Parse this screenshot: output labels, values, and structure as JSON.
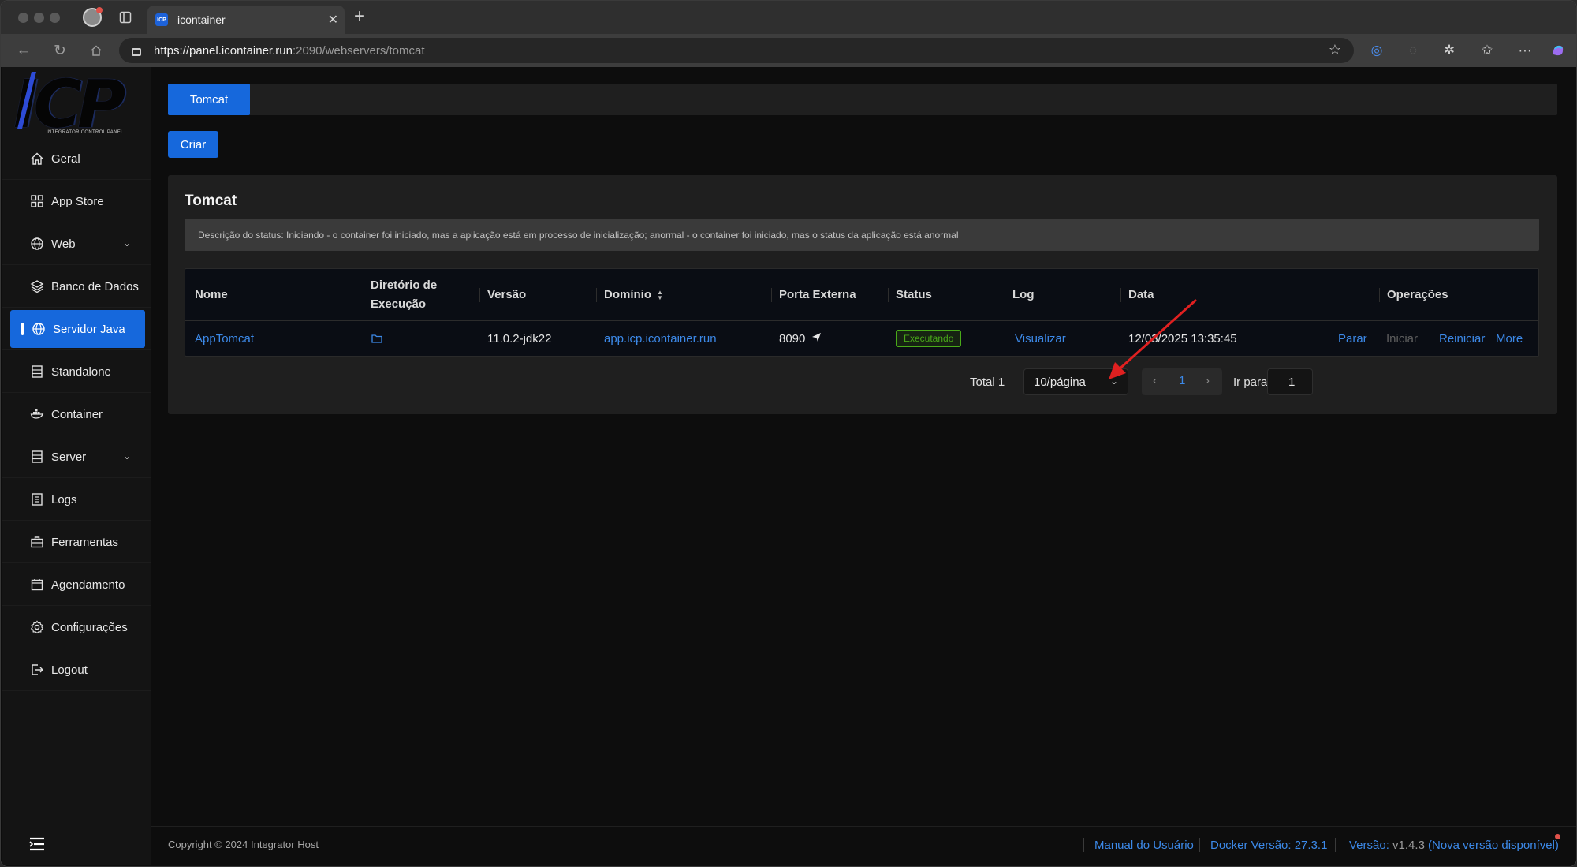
{
  "browser": {
    "tab_title": "icontainer",
    "tab_favicon": "ICP",
    "url_host": "https://panel.icontainer.run",
    "url_path": ":2090/webservers/tomcat"
  },
  "logo": {
    "text": "ICP",
    "subtitle": "INTEGRATOR CONTROL PANEL"
  },
  "sidebar": {
    "items": [
      {
        "label": "Geral",
        "icon": "home-icon"
      },
      {
        "label": "App Store",
        "icon": "grid-icon"
      },
      {
        "label": "Web",
        "icon": "globe-icon",
        "has_submenu": true
      },
      {
        "label": "Banco de Dados",
        "icon": "layers-icon"
      },
      {
        "label": "Servidor Java",
        "icon": "globe-icon",
        "active": true
      },
      {
        "label": "Standalone",
        "icon": "server-icon"
      },
      {
        "label": "Container",
        "icon": "docker-icon"
      },
      {
        "label": "Server",
        "icon": "server-icon",
        "has_submenu": true
      },
      {
        "label": "Logs",
        "icon": "list-icon"
      },
      {
        "label": "Ferramentas",
        "icon": "toolbox-icon"
      },
      {
        "label": "Agendamento",
        "icon": "calendar-icon"
      },
      {
        "label": "Configurações",
        "icon": "gear-icon"
      },
      {
        "label": "Logout",
        "icon": "logout-icon"
      }
    ]
  },
  "main": {
    "tab_label": "Tomcat",
    "create_label": "Criar",
    "card_title": "Tomcat",
    "status_description": "Descrição do status: Iniciando - o container foi iniciado, mas a aplicação está em processo de inicialização; anormal - o container foi iniciado, mas o status da aplicação está anormal",
    "table": {
      "headers": {
        "name": "Nome",
        "dir_line1": "Diretório de",
        "dir_line2": "Execução",
        "version": "Versão",
        "domain": "Domínio",
        "port": "Porta Externa",
        "status": "Status",
        "log": "Log",
        "date": "Data",
        "operations": "Operações"
      },
      "rows": [
        {
          "name": "AppTomcat",
          "version": "11.0.2-jdk22",
          "domain": "app.icp.icontainer.run",
          "port": "8090",
          "status": "Executando",
          "log": "Visualizar",
          "date": "12/03/2025 13:35:45",
          "ops": {
            "stop": "Parar",
            "start": "Iniciar",
            "restart": "Reiniciar",
            "more": "More"
          }
        }
      ]
    },
    "pagination": {
      "total": "Total 1",
      "page_size": "10/página",
      "current_page": "1",
      "goto_label": "Ir para",
      "goto_value": "1"
    }
  },
  "footer": {
    "copyright": "Copyright © 2024 Integrator Host",
    "manual": "Manual do Usuário",
    "docker": "Docker Versão: 27.3.1",
    "version_label": "Versão: ",
    "version_value": "v1.4.3",
    "new_version": "(Nova versão disponível)"
  },
  "colors": {
    "accent": "#1668dc",
    "link": "#3c89e8",
    "success": "#49aa19",
    "annotation_arrow": "#e02020"
  }
}
